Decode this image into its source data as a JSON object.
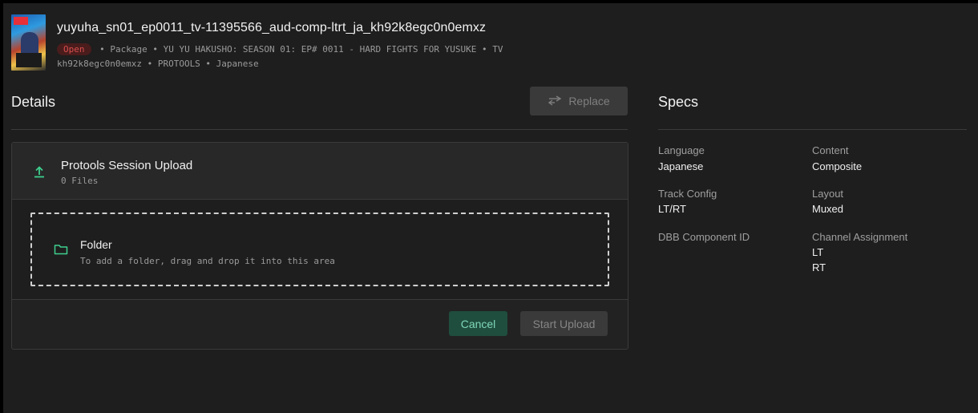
{
  "asset": {
    "title": "yuyuha_sn01_ep0011_tv-11395566_aud-comp-ltrt_ja_kh92k8egc0n0emxz",
    "status": "Open",
    "meta_line1": "• Package • YU YU HAKUSHO: SEASON 01: EP# 0011 - HARD FIGHTS FOR YUSUKE • TV",
    "meta_line2": "kh92k8egc0n0emxz • PROTOOLS • Japanese",
    "thumbnail_icon": "poster-thumbnail"
  },
  "details": {
    "heading": "Details",
    "replace_label": "Replace",
    "replace_icon": "swap-arrows-icon"
  },
  "upload": {
    "title": "Protools Session Upload",
    "file_count": "0 Files",
    "upload_icon": "upload-icon",
    "dropzone": {
      "title": "Folder",
      "hint": "To add a folder, drag and drop it into this area",
      "icon": "folder-icon"
    },
    "cancel_label": "Cancel",
    "start_label": "Start Upload"
  },
  "specs": {
    "heading": "Specs",
    "items": [
      {
        "label": "Language",
        "value": "Japanese"
      },
      {
        "label": "Content",
        "value": "Composite"
      },
      {
        "label": "Track Config",
        "value": "LT/RT"
      },
      {
        "label": "Layout",
        "value": "Muxed"
      },
      {
        "label": "DBB Component ID",
        "value": ""
      },
      {
        "label": "Channel Assignment",
        "value": "LT",
        "value2": "RT"
      }
    ]
  },
  "colors": {
    "background": "#1e1e1e",
    "accent_green": "#1f4d3e",
    "status_red": "#d74e4e"
  }
}
